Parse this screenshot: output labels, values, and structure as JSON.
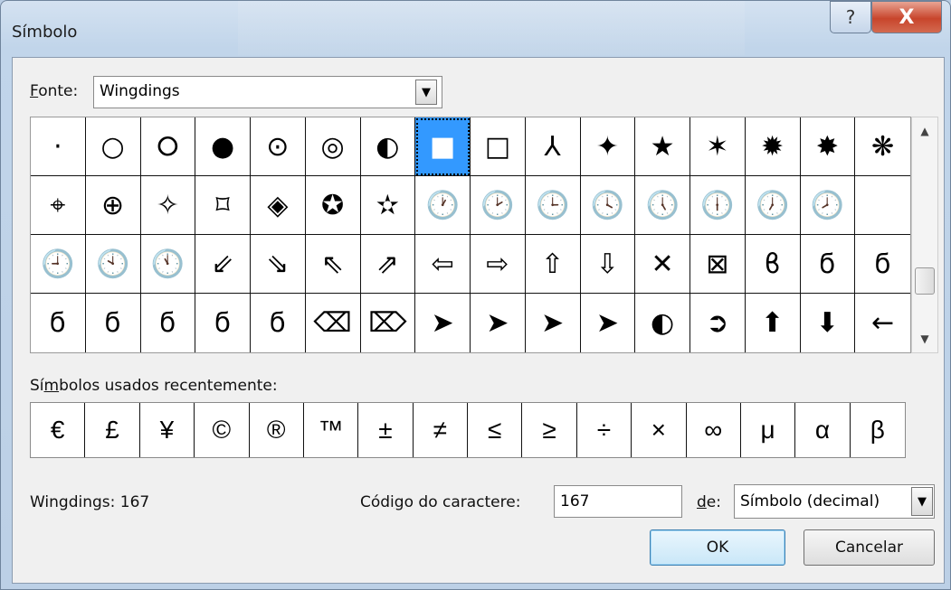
{
  "window": {
    "title": "Símbolo",
    "help_glyph": "?",
    "close_glyph": "X"
  },
  "font_row": {
    "label_prefix_underlined": "F",
    "label_rest": "onte:",
    "value": "Wingdings",
    "dropdown_glyph": "▼"
  },
  "symbol_grid": [
    [
      "·",
      "○",
      "⭘",
      "●",
      "⊙",
      "◎",
      "◐",
      "■",
      "□",
      "⅄",
      "✦",
      "★",
      "✶",
      "✹",
      "✸",
      "❋"
    ],
    [
      "⌖",
      "⊕",
      "✧",
      "⌑",
      "◈",
      "✪",
      "✫",
      "🕐",
      "🕑",
      "🕒",
      "🕓",
      "🕔",
      "🕕",
      "🕖",
      "🕗"
    ],
    [
      "🕘",
      "🕙",
      "🕚",
      "⇙",
      "⇘",
      "⇖",
      "⇗",
      "⇦",
      "⇨",
      "⇧",
      "⇩",
      "✕",
      "⊠",
      "ϐ",
      "ϭ",
      "ϭ"
    ],
    [
      "ϭ",
      "ϭ",
      "ϭ",
      "ϭ",
      "ϭ",
      "⌫",
      "⌦",
      "➤",
      "➤",
      "➤",
      "➤",
      "◐",
      "➲",
      "⬆",
      "⬇",
      "←"
    ]
  ],
  "selected_cell": {
    "row": 0,
    "col": 7
  },
  "scrollbar": {
    "up_glyph": "▲",
    "down_glyph": "▼"
  },
  "recent": {
    "label_pre": "Sí",
    "label_underlined": "m",
    "label_post": "bolos usados recentemente:",
    "symbols": [
      "€",
      "£",
      "¥",
      "©",
      "®",
      "™",
      "±",
      "≠",
      "≤",
      "≥",
      "÷",
      "×",
      "∞",
      "μ",
      "α",
      "β"
    ]
  },
  "status": {
    "font_code": "Wingdings: 167"
  },
  "char_code": {
    "label_pre": "Códi",
    "label_underlined": "g",
    "label_post": "o do caractere:",
    "value": "167"
  },
  "from": {
    "label_underlined": "d",
    "label_post": "e:",
    "value": "Símbolo (decimal)",
    "dropdown_glyph": "▼"
  },
  "buttons": {
    "ok": "OK",
    "cancel": "Cancelar"
  }
}
